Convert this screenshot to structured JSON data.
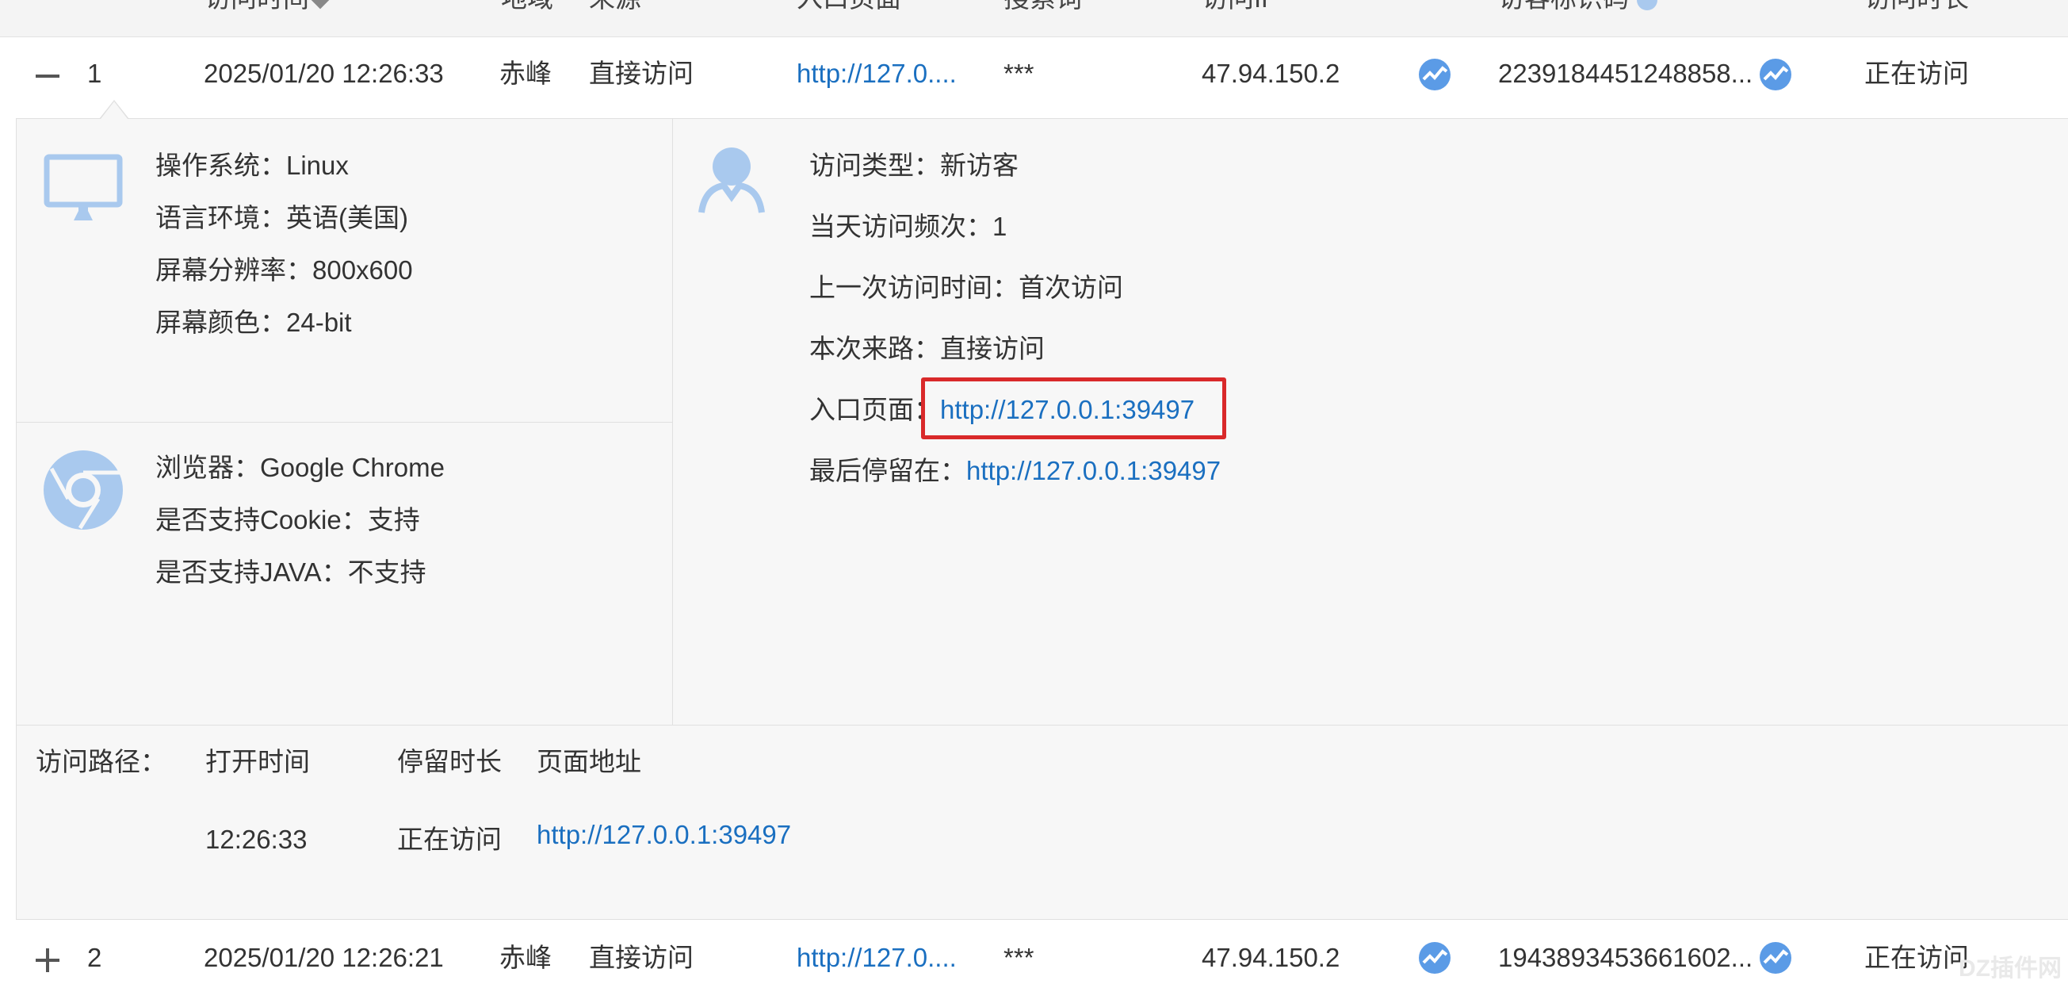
{
  "header": {
    "cols": [
      "访问时间",
      "地域",
      "来源",
      "入口页面",
      "搜索词",
      "访问IP",
      "访客标识码",
      "访问时长"
    ]
  },
  "rows": [
    {
      "index": "1",
      "time": "2025/01/20 12:26:33",
      "region": "赤峰",
      "source": "直接访问",
      "entry": "http://127.0....",
      "keyword": "***",
      "ip": "47.94.150.2",
      "visitor_id": "2239184451248858...",
      "duration": "正在访问"
    },
    {
      "index": "2",
      "time": "2025/01/20 12:26:21",
      "region": "赤峰",
      "source": "直接访问",
      "entry": "http://127.0....",
      "keyword": "***",
      "ip": "47.94.150.2",
      "visitor_id": "1943893453661602...",
      "duration": "正在访问"
    }
  ],
  "detail": {
    "system": {
      "os_label": "操作系统：",
      "os_value": "Linux",
      "lang_label": "语言环境：",
      "lang_value": "英语(美国)",
      "res_label": "屏幕分辨率：",
      "res_value": "800x600",
      "color_label": "屏幕颜色：",
      "color_value": "24-bit"
    },
    "browser": {
      "browser_label": "浏览器：",
      "browser_value": "Google Chrome",
      "cookie_label": "是否支持Cookie：",
      "cookie_value": "支持",
      "java_label": "是否支持JAVA：",
      "java_value": "不支持"
    },
    "visit": {
      "type_label": "访问类型：",
      "type_value": "新访客",
      "freq_label": "当天访问频次：",
      "freq_value": "1",
      "last_label": "上一次访问时间：",
      "last_value": "首次访问",
      "src_label": "本次来路：",
      "src_value": "直接访问",
      "entry_label": "入口页面：",
      "entry_value": "http://127.0.0.1:39497",
      "stay_label": "最后停留在：",
      "stay_value": "http://127.0.0.1:39497"
    },
    "path": {
      "label": "访问路径：",
      "col_open": "打开时间",
      "col_stay": "停留时长",
      "col_url": "页面地址",
      "open_time": "12:26:33",
      "stay": "正在访问",
      "url": "http://127.0.0.1:39497"
    }
  },
  "watermark": "DZ插件网",
  "colors": {
    "link": "#1a6fc0",
    "highlight": "#d9292a",
    "icon": "#a9c9ee"
  }
}
